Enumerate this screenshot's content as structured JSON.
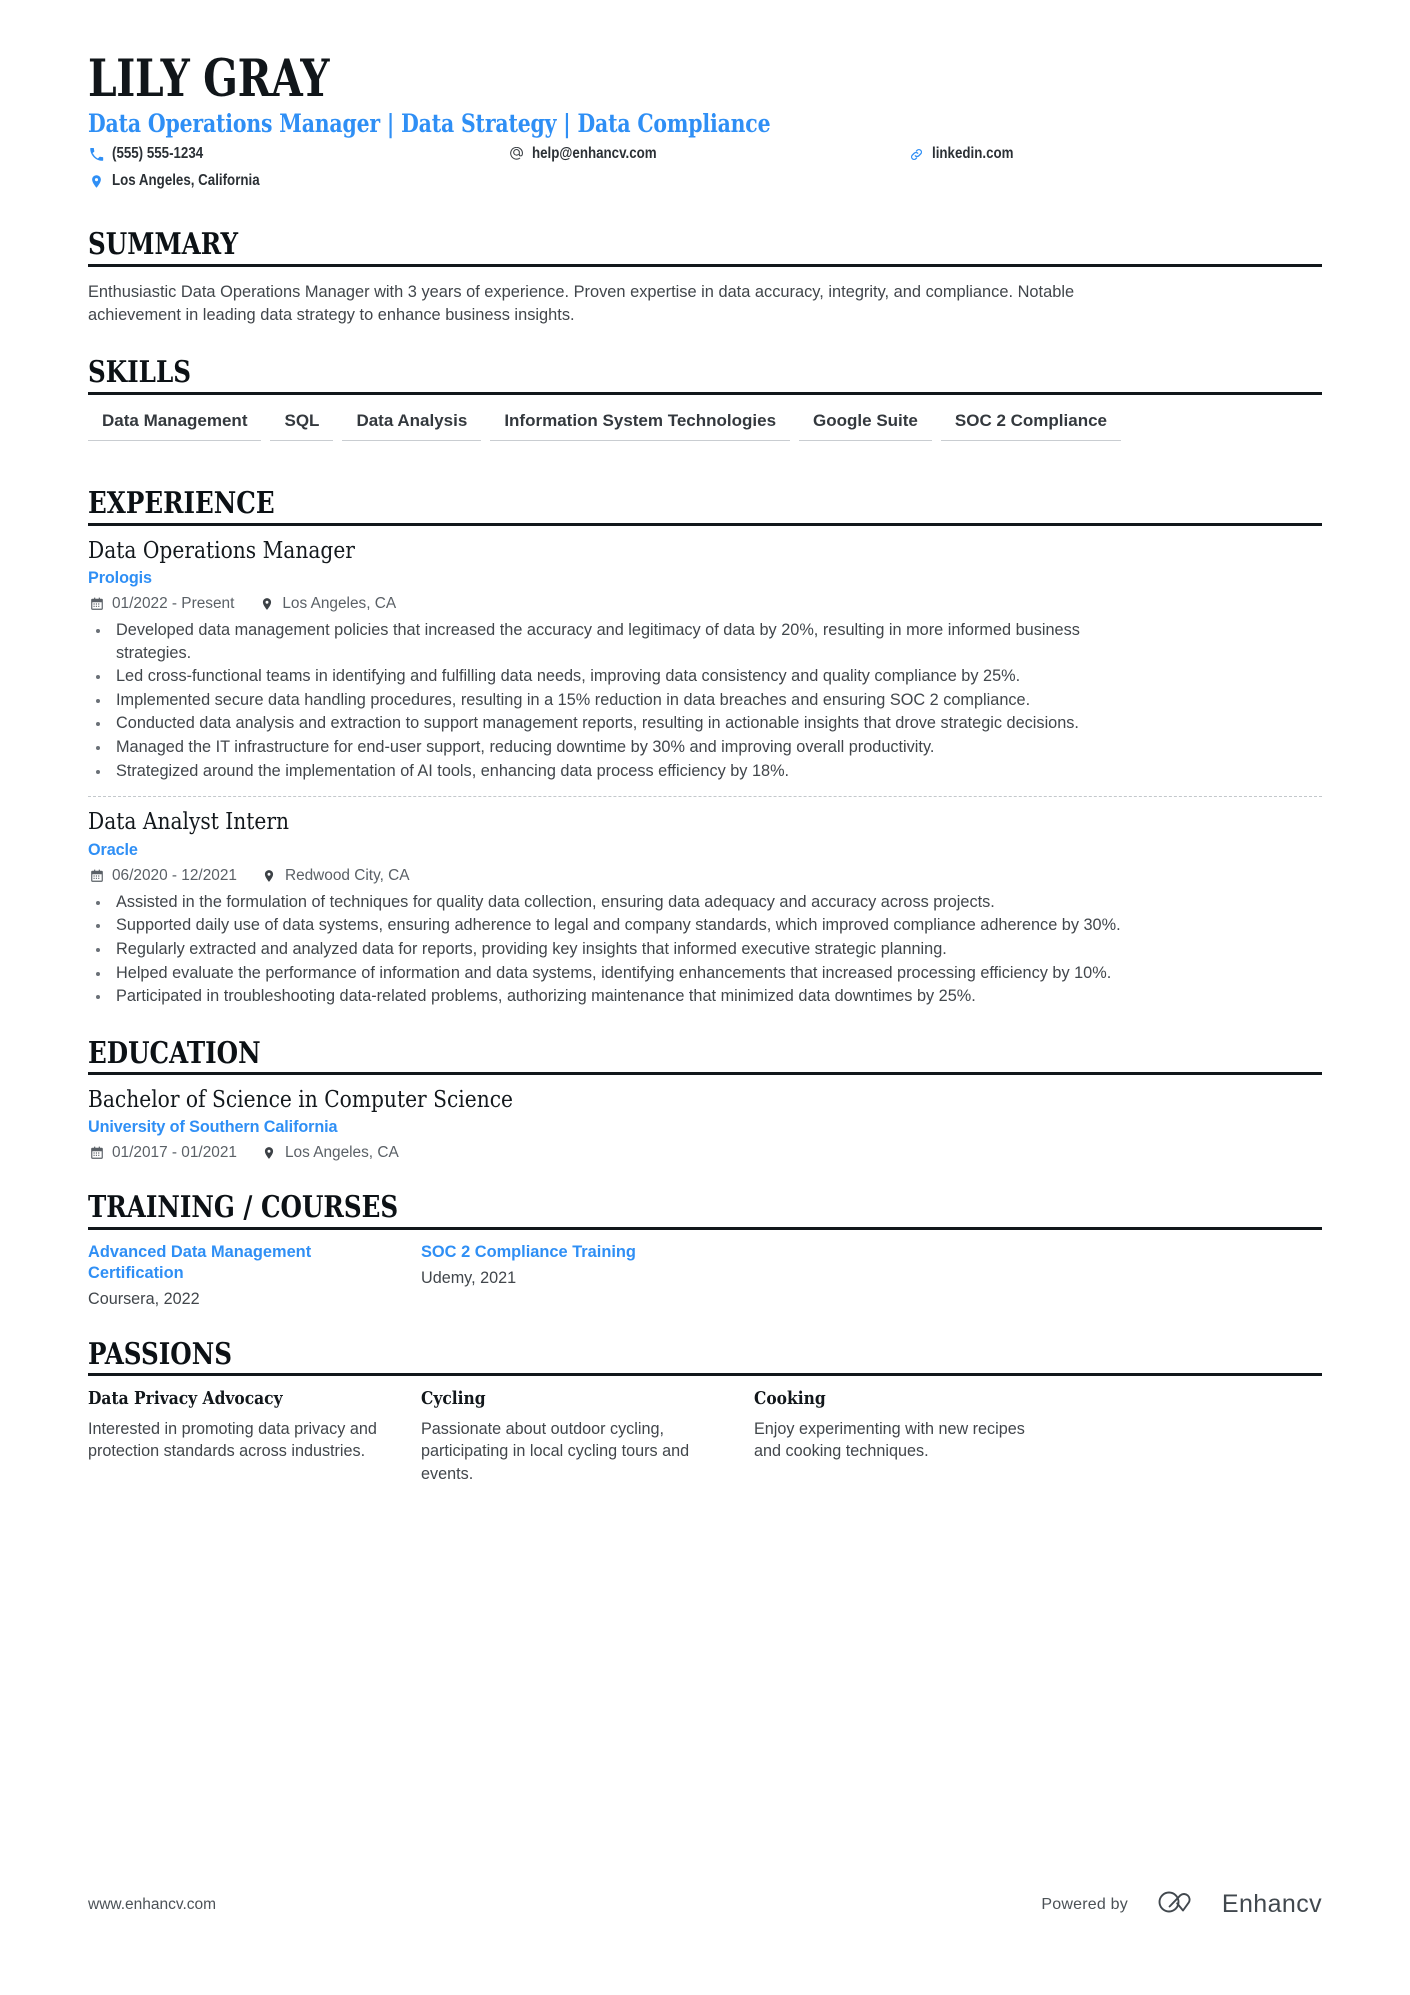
{
  "colors": {
    "accent": "#2f8ff5",
    "heading": "#12171b",
    "body": "#41464b",
    "muted": "#5a6066",
    "tag_underline": "#c9cdd1"
  },
  "header": {
    "name": "LILY GRAY",
    "headline": "Data Operations Manager | Data Strategy | Data Compliance",
    "contacts": [
      {
        "icon": "phone-icon",
        "text": "(555) 555-1234"
      },
      {
        "icon": "email-icon",
        "text": "help@enhancv.com"
      },
      {
        "icon": "link-icon",
        "text": "linkedin.com"
      },
      {
        "icon": "location-icon",
        "text": "Los Angeles, California"
      }
    ]
  },
  "sections": {
    "summary": {
      "title": "SUMMARY",
      "text": "Enthusiastic Data Operations Manager with 3 years of experience. Proven expertise in data accuracy, integrity, and compliance. Notable achievement in leading data strategy to enhance business insights."
    },
    "skills": {
      "title": "SKILLS",
      "items": [
        "Data Management",
        "SQL",
        "Data Analysis",
        "Information System Technologies",
        "Google Suite",
        "SOC 2 Compliance"
      ]
    },
    "experience": {
      "title": "EXPERIENCE",
      "entries": [
        {
          "title": "Data Operations Manager",
          "company": "Prologis",
          "dates": "01/2022 - Present",
          "location": "Los Angeles, CA",
          "bullets": [
            "Developed data management policies that increased the accuracy and legitimacy of data by 20%, resulting in more informed business strategies.",
            "Led cross-functional teams in identifying and fulfilling data needs, improving data consistency and quality compliance by 25%.",
            "Implemented secure data handling procedures, resulting in a 15% reduction in data breaches and ensuring SOC 2 compliance.",
            "Conducted data analysis and extraction to support management reports, resulting in actionable insights that drove strategic decisions.",
            "Managed the IT infrastructure for end-user support, reducing downtime by 30% and improving overall productivity.",
            "Strategized around the implementation of AI tools, enhancing data process efficiency by 18%."
          ]
        },
        {
          "title": "Data Analyst Intern",
          "company": "Oracle",
          "dates": "06/2020 - 12/2021",
          "location": "Redwood City, CA",
          "bullets": [
            "Assisted in the formulation of techniques for quality data collection, ensuring data adequacy and accuracy across projects.",
            "Supported daily use of data systems, ensuring adherence to legal and company standards, which improved compliance adherence by 30%.",
            "Regularly extracted and analyzed data for reports, providing key insights that informed executive strategic planning.",
            "Helped evaluate the performance of information and data systems, identifying enhancements that increased processing efficiency by 10%.",
            "Participated in troubleshooting data-related problems, authorizing maintenance that minimized data downtimes by 25%."
          ]
        }
      ]
    },
    "education": {
      "title": "EDUCATION",
      "entries": [
        {
          "title": "Bachelor of Science in Computer Science",
          "school": "University of Southern California",
          "dates": "01/2017 - 01/2021",
          "location": "Los Angeles, CA"
        }
      ]
    },
    "training": {
      "title": "TRAINING / COURSES",
      "items": [
        {
          "name": "Advanced Data Management Certification",
          "meta": "Coursera, 2022"
        },
        {
          "name": "SOC 2 Compliance Training",
          "meta": "Udemy, 2021"
        }
      ]
    },
    "passions": {
      "title": "PASSIONS",
      "items": [
        {
          "title": "Data Privacy Advocacy",
          "text": "Interested in promoting data privacy and protection standards across industries."
        },
        {
          "title": "Cycling",
          "text": "Passionate about outdoor cycling, participating in local cycling tours and events."
        },
        {
          "title": "Cooking",
          "text": "Enjoy experimenting with new recipes and cooking techniques."
        }
      ]
    }
  },
  "footer": {
    "url": "www.enhancv.com",
    "powered_by": "Powered by",
    "brand": "Enhancv"
  }
}
